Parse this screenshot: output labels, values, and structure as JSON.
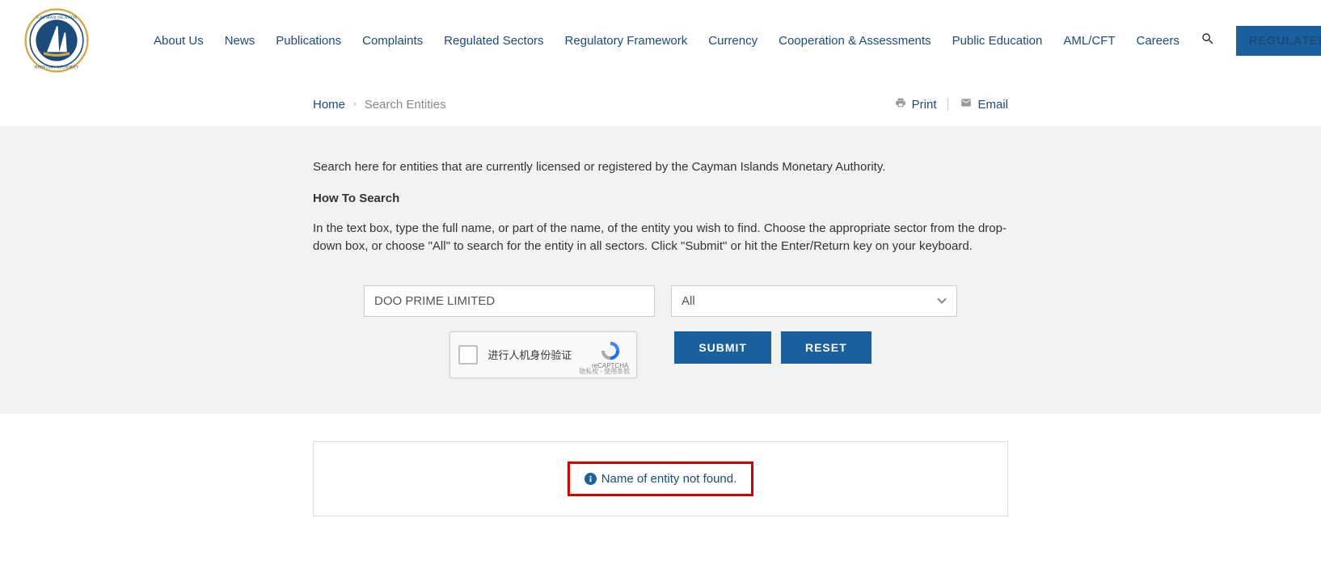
{
  "nav": {
    "items": [
      "About Us",
      "News",
      "Publications",
      "Complaints",
      "Regulated Sectors",
      "Regulatory Framework",
      "Currency",
      "Cooperation & Assessments",
      "Public Education",
      "AML/CFT",
      "Careers"
    ],
    "cta": "REGULATED ENTITIES"
  },
  "breadcrumb": {
    "home": "Home",
    "current": "Search Entities"
  },
  "actions": {
    "print": "Print",
    "email": "Email"
  },
  "content": {
    "intro": "Search here for entities that are currently licensed or registered by the Cayman Islands Monetary Authority.",
    "howto_title": "How To Search",
    "howto_text": "In the text box, type the full name, or part of the name, of the entity you wish to find. Choose the appropriate sector from the drop-down box, or choose \"All\" to search for the entity in all sectors. Click \"Submit\" or hit the Enter/Return key on your keyboard."
  },
  "form": {
    "search_value": "DOO PRIME LIMITED",
    "sector_value": "All",
    "submit": "SUBMIT",
    "reset": "RESET"
  },
  "recaptcha": {
    "label": "进行人机身份验证",
    "brand": "reCAPTCHA",
    "foot": "隐私权 - 使用条款"
  },
  "result": {
    "message": "Name of entity not found."
  }
}
